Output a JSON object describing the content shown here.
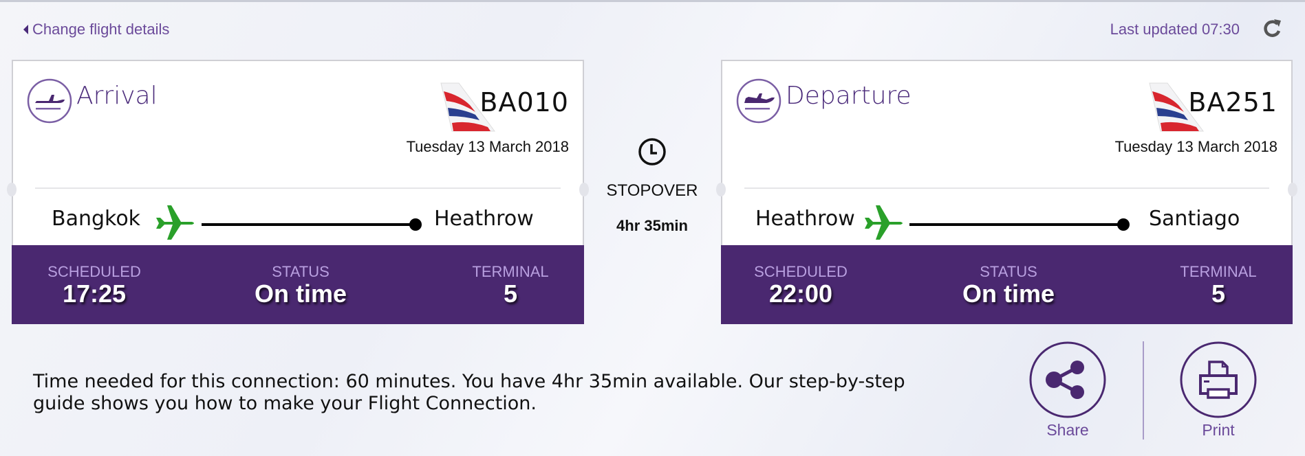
{
  "header": {
    "back_link": "Change flight details",
    "last_updated": "Last updated 07:30",
    "refresh_icon": "refresh-icon"
  },
  "colors": {
    "brand_purple": "#4a2870",
    "link_purple": "#6b4a9a",
    "label_lavender": "#b9a0e0",
    "plane_green": "#2aa02a"
  },
  "arrival": {
    "title": "Arrival",
    "icon": "plane-landing-icon",
    "flight_number": "BA010",
    "date": "Tuesday 13 March 2018",
    "from": "Bangkok",
    "to": "Heathrow",
    "scheduled_label": "SCHEDULED",
    "scheduled": "17:25",
    "status_label": "STATUS",
    "status": "On time",
    "terminal_label": "TERMINAL",
    "terminal": "5"
  },
  "stopover": {
    "icon": "clock-icon",
    "label": "STOPOVER",
    "duration": "4hr 35min"
  },
  "departure": {
    "title": "Departure",
    "icon": "plane-takeoff-icon",
    "flight_number": "BA251",
    "date": "Tuesday 13 March 2018",
    "from": "Heathrow",
    "to": "Santiago",
    "scheduled_label": "SCHEDULED",
    "scheduled": "22:00",
    "status_label": "STATUS",
    "status": "On time",
    "terminal_label": "TERMINAL",
    "terminal": "5"
  },
  "connection_note": "Time needed for this connection: 60 minutes. You have 4hr 35min available. Our step-by-step guide shows you how to make your Flight Connection.",
  "actions": {
    "share": "Share",
    "print": "Print"
  }
}
